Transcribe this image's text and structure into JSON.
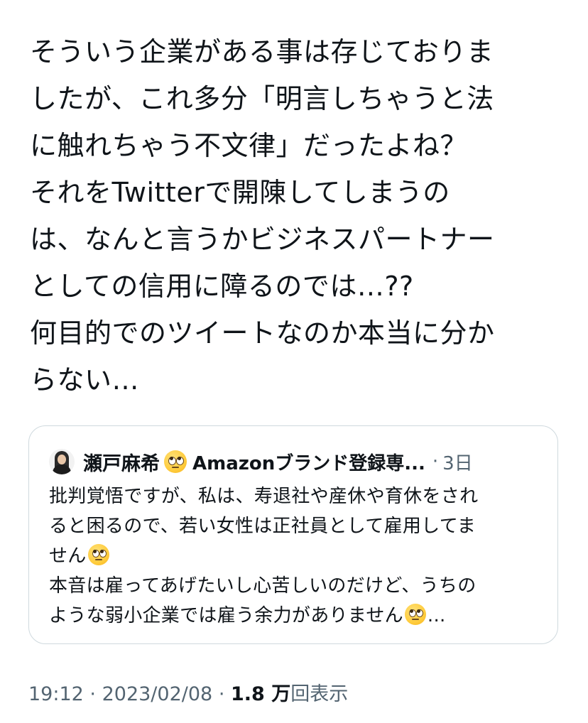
{
  "tweet": {
    "lines": [
      "そういう企業がある事は存じておりま",
      "したが、これ多分「明言しちゃうと法",
      "に触れちゃう不文律」だったよね？",
      "それをTwitterで開陳してしまうの",
      "は、なんと言うかビジネスパートナー",
      "としての信用に障るのでは…??",
      "何目的でのツイートなのか本当に分か",
      "らない…"
    ]
  },
  "quoted_tweet": {
    "author_name": "瀬戸麻希",
    "name_emoji": "face-with-rolling-eyes-emoji",
    "author_title": "Amazonブランド登録専...",
    "separator": "·",
    "age": "3日",
    "text": {
      "line1": "批判覚悟ですが、私は、寿退社や産休や育休をされ",
      "line2": "ると困るので、若い女性は正社員として雇用してま",
      "line3": "せん",
      "line4": "本音は雇ってあげたいし心苦しいのだけど、うちの",
      "line5_text": "ような弱小企業では雇う余力がありません",
      "line5_suffix": "..."
    }
  },
  "meta": {
    "time": "19:12",
    "dot1": "·",
    "date": "2023/02/08",
    "dot2": "·",
    "views_count": "1.8 万",
    "views_label": "回表示"
  },
  "colors": {
    "text_primary": "#0f1419",
    "text_secondary": "#536471",
    "card_border": "#cfd9de",
    "background": "#ffffff"
  }
}
